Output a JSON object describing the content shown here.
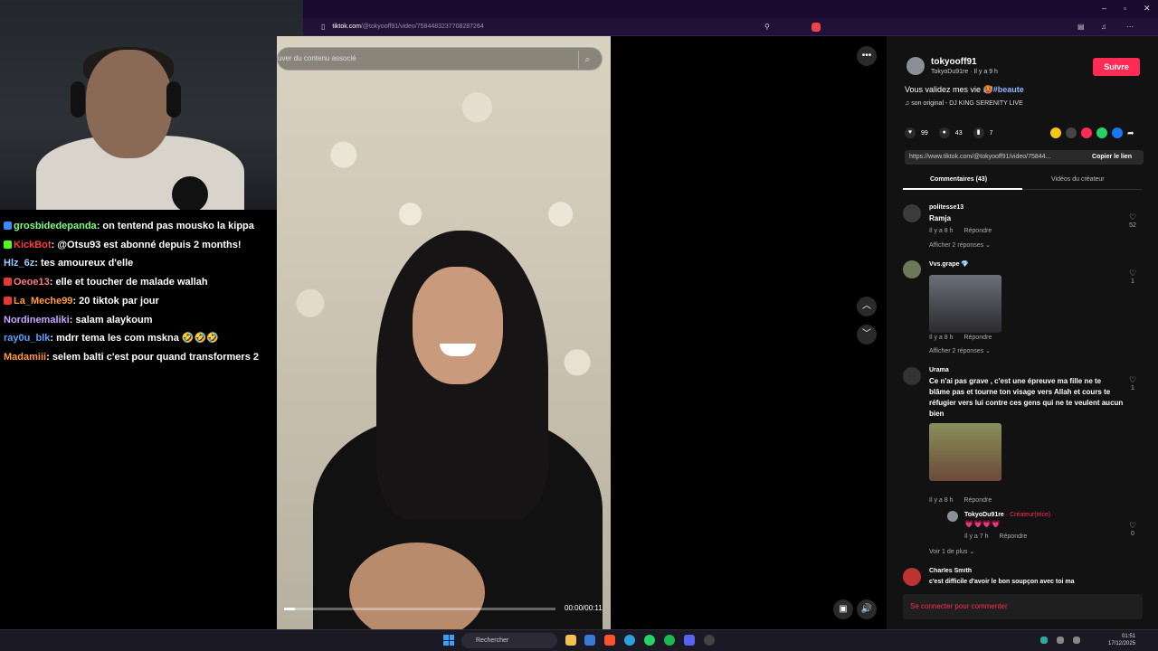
{
  "browser": {
    "url_host": "tiktok.com",
    "url_path": "/@tokyooff91/video/7584483237708287264"
  },
  "chat": {
    "messages": [
      {
        "user": "grosbidedepanda",
        "text": "on tentend pas mousko la kippa",
        "color": "#7cff7c",
        "badge": "#3a8bff"
      },
      {
        "user": "KickBot",
        "text": "@Otsu93 est abonné depuis 2 months!",
        "color": "#ff3d3d",
        "badge": "#53fc18"
      },
      {
        "user": "Hlz_6z",
        "text": "tes amoureux d'elle",
        "color": "#9ec7ff",
        "badge": ""
      },
      {
        "user": "Oeoe13",
        "text": "elle et toucher de malade wallah",
        "color": "#ff7a7a",
        "badge": "#e53935"
      },
      {
        "user": "La_Meche99",
        "text": "20 tiktok par jour",
        "color": "#ff9a3d",
        "badge": "#e53935"
      },
      {
        "user": "Nordinemaliki",
        "text": "salam alaykoum",
        "color": "#c9a5ff",
        "badge": ""
      },
      {
        "user": "ray0u_blk",
        "text": "mdrr tema les com mskna 🤣🤣🤣",
        "color": "#5aa0ff",
        "badge": ""
      },
      {
        "user": "Madamiii",
        "text": "selem balti c'est pour quand transformers 2",
        "color": "#ff9a3d",
        "badge": ""
      }
    ]
  },
  "video": {
    "search_placeholder": "uver du contenu associé",
    "timecode": "00:00/00:11",
    "progress": 0.04
  },
  "panel": {
    "author": "tokyooff91",
    "author_sub": "TokyoDu91re · Il y a 9 h",
    "follow_label": "Suivre",
    "caption": "Vous validez mes vie 🥵",
    "hashtag": "#beaute",
    "music": "♫  son original - DJ KING SERENITY LIVE",
    "likes": "99",
    "comments_count": "43",
    "saves": "7",
    "link": "https://www.tiktok.com/@tokyooff91/video/75844...",
    "copy_label": "Copier le lien",
    "tab_comments": "Commentaires (43)",
    "tab_creator": "Vidéos du créateur",
    "comments": [
      {
        "name": "politesse13",
        "text": "Ramja",
        "meta": "Il y a 8 h",
        "reply": "Répondre",
        "more": "Afficher 2 réponses ⌄",
        "likes": "52"
      },
      {
        "name": "Vvs.grape 💎",
        "text": "",
        "meta": "Il y a 8 h",
        "reply": "Répondre",
        "more": "Afficher 2 réponses ⌄",
        "likes": "1"
      },
      {
        "name": "Urama",
        "text": "Ce n'ai pas grave , c'est une épreuve ma fille ne te blâme pas et tourne ton visage vers Allah et cours te réfugier vers lui contre ces gens qui ne te veulent aucun bien",
        "meta": "Il y a 8 h",
        "reply": "Répondre",
        "more": "",
        "likes": "1"
      },
      {
        "name": "Charles Smith",
        "text": "c'est difficile d'avoir le bon soupçon avec toi ma",
        "meta": "",
        "reply": "",
        "more": "",
        "likes": ""
      }
    ],
    "reply": {
      "name": "TokyoDu91re",
      "role": " · Créateur(trice)",
      "text": "💗💗💗💗",
      "meta": "Il y a 7 h",
      "reply": "Répondre",
      "likes": "0",
      "more": "Voir 1 de plus ⌄"
    },
    "login": "Se connecter pour commenter"
  },
  "taskbar": {
    "search": "Rechercher",
    "time": "01:51",
    "date": "17/12/2025"
  }
}
